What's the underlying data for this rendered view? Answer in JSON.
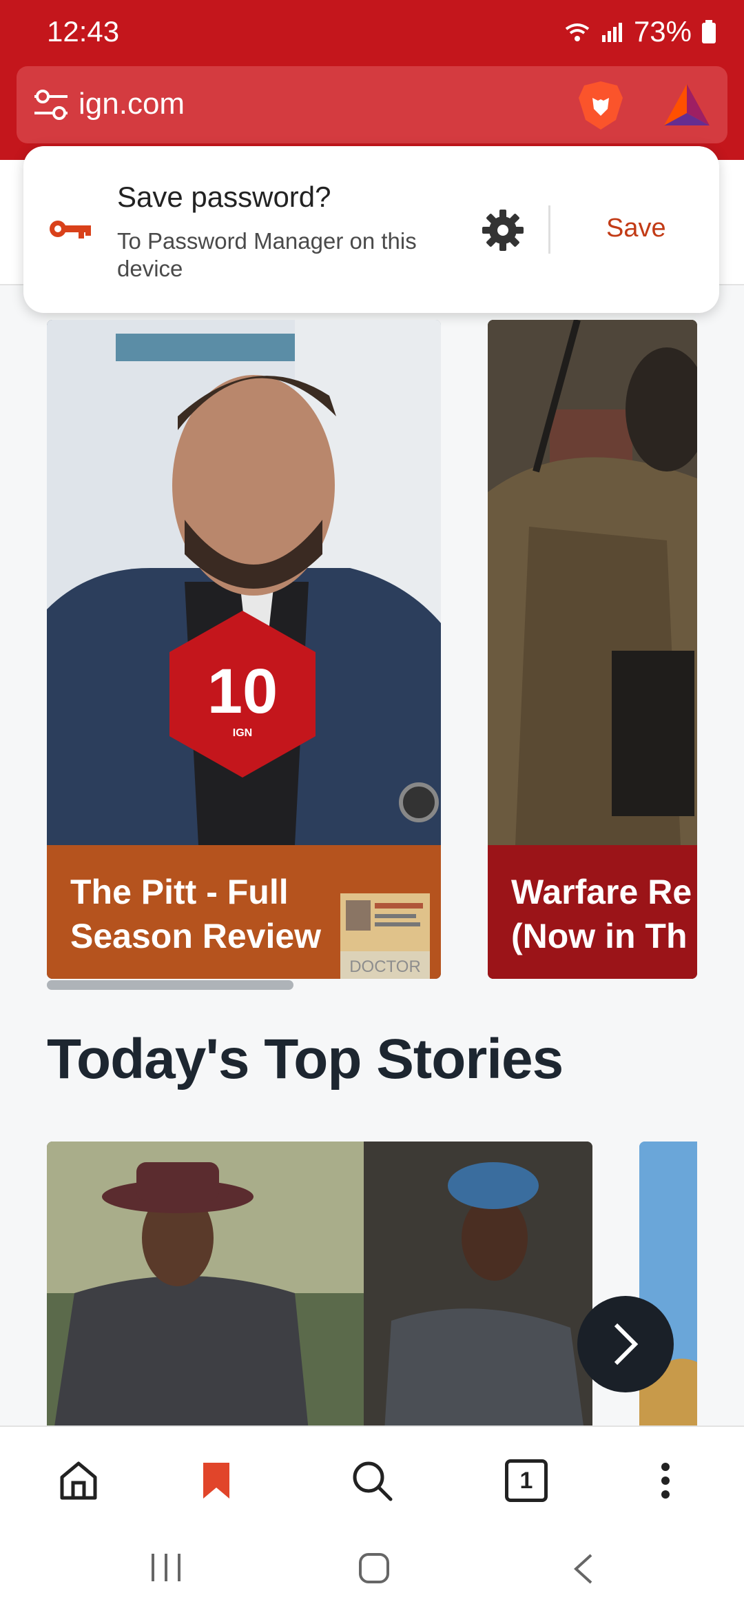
{
  "status": {
    "time": "12:43",
    "battery": "73%"
  },
  "browser": {
    "url": "ign.com"
  },
  "password_prompt": {
    "title": "Save password?",
    "subtitle": "To Password Manager on this device",
    "save_label": "Save"
  },
  "carousel": [
    {
      "title_line1": "The Pitt - Full",
      "title_line2": "Season Review",
      "score": "10",
      "score_brand": "IGN",
      "badge_text": "DOCTOR"
    },
    {
      "title_line1": "Warfare Re",
      "title_line2": "(Now in Th"
    }
  ],
  "section": {
    "title": "Today's Top Stories"
  },
  "bottom_nav": {
    "tab_count": "1"
  },
  "colors": {
    "brand": "#c4161c",
    "accent": "#c23b16",
    "dark": "#1d2630"
  }
}
